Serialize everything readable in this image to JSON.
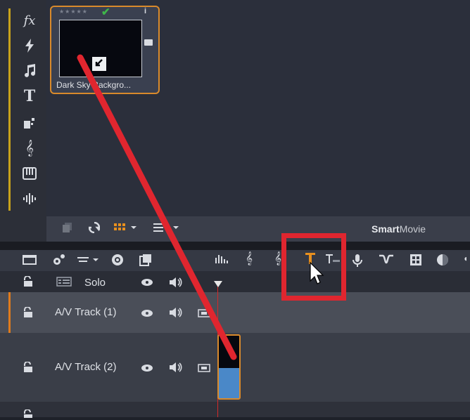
{
  "left_toolbar": {
    "accent_color": "#c8a21b",
    "icons": [
      "fx-icon",
      "lightning-icon",
      "music-note-icon",
      "text-title-icon",
      "transition-icon",
      "treble-clef-icon",
      "piano-icon",
      "sound-wave-icon"
    ],
    "fx_glyph": "fx",
    "title_glyph": "T"
  },
  "library": {
    "item": {
      "label": "Dark Sky Backgro...",
      "rating_stars": "★★★★★",
      "selected": true,
      "border_color": "#d98a2b"
    }
  },
  "library_bar": {
    "brand_bold": "Smart",
    "brand_rest": "Movie"
  },
  "timeline_toolbar": {
    "highlighted_tool": "title-track-icon",
    "highlight_color": "#e0262f"
  },
  "tracks": [
    {
      "name": "Solo"
    },
    {
      "name": "A/V Track (1)"
    },
    {
      "name": "A/V Track (2)"
    }
  ],
  "annotation": {
    "arrow_color": "#e0262f"
  }
}
